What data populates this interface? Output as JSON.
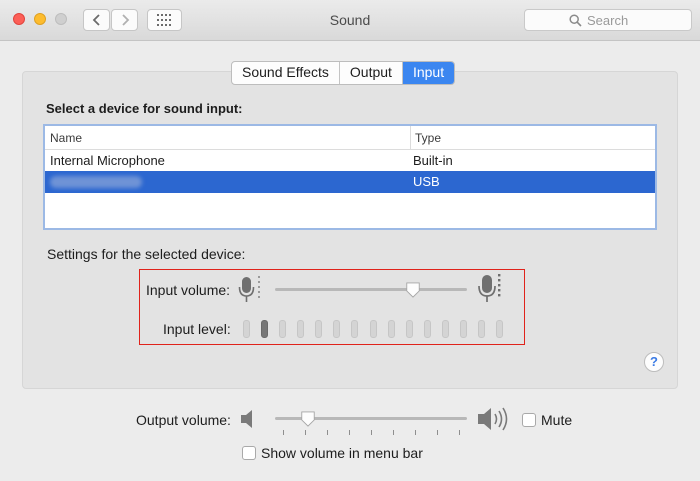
{
  "window": {
    "title": "Sound",
    "search_placeholder": "Search"
  },
  "tabs": [
    {
      "label": "Sound Effects",
      "active": false
    },
    {
      "label": "Output",
      "active": false
    },
    {
      "label": "Input",
      "active": true
    }
  ],
  "input": {
    "device_heading": "Select a device for sound input:",
    "columns": {
      "name": "Name",
      "type": "Type"
    },
    "devices": [
      {
        "name": "Internal Microphone",
        "type": "Built-in",
        "selected": false
      },
      {
        "name": "",
        "type": "USB",
        "selected": true
      }
    ],
    "settings_heading": "Settings for the selected device:",
    "input_volume_label": "Input volume:",
    "input_volume_level": 0.72,
    "input_level_label": "Input level:",
    "input_level_active_bars": 1,
    "input_level_total_bars": 15
  },
  "footer": {
    "output_volume_label": "Output volume:",
    "output_volume_level": 0.17,
    "mute_label": "Mute",
    "mute_checked": false,
    "show_volume_label": "Show volume in menu bar",
    "show_volume_checked": false
  },
  "colors": {
    "accent": "#3b86f0",
    "selection": "#2c67d0",
    "highlight_box": "#e0231b"
  },
  "icons": [
    "back-chevron-icon",
    "forward-chevron-icon",
    "grid-icon",
    "search-icon",
    "microphone-icon",
    "speaker-low-icon",
    "speaker-high-icon",
    "help-icon"
  ]
}
